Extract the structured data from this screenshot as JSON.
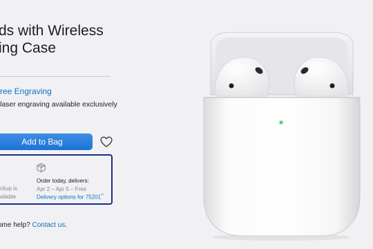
{
  "product": {
    "title_line1": "ds with Wireless",
    "title_line2": "ing Case"
  },
  "engraving": {
    "link_text": "ree Engraving",
    "description": "laser engraving available exclusively"
  },
  "actions": {
    "add_to_bag": "Add to Bag",
    "favorite_icon": "heart-outline-icon"
  },
  "delivery": {
    "pickup_line1": "ckup is",
    "pickup_line2": "ailable",
    "box_icon": "package-icon",
    "order_title": "Order today, delivers:",
    "order_dates": "Apr 2 – Apr 5 – Free",
    "options_text": "Delivery options for 75201",
    "options_note_mark": "**"
  },
  "help": {
    "prefix": "ome help?",
    "contact_link": "Contact us",
    "suffix": "."
  },
  "colors": {
    "background": "#f1f1f3",
    "link_blue": "#0a6fc9",
    "button_blue": "#1c73d6",
    "highlight_border": "#1b2c8a",
    "status_led": "#3ec96b"
  }
}
